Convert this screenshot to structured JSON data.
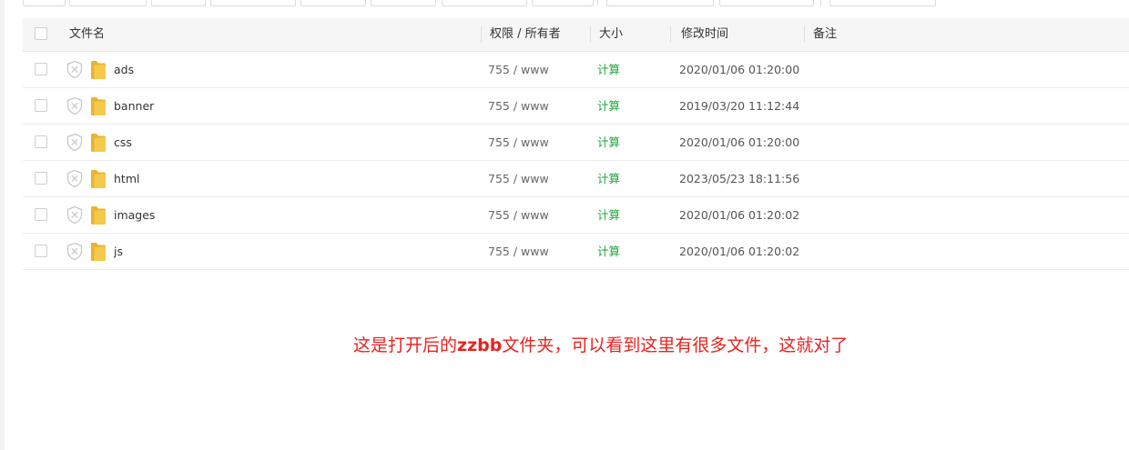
{
  "table": {
    "headers": {
      "name": "文件名",
      "perm": "权限 / 所有者",
      "size": "大小",
      "mtime": "修改时间",
      "note": "备注"
    },
    "rows": [
      {
        "name": "ads",
        "perm": "755 / www",
        "size": "计算",
        "mtime": "2020/01/06 01:20:00"
      },
      {
        "name": "banner",
        "perm": "755 / www",
        "size": "计算",
        "mtime": "2019/03/20 11:12:44"
      },
      {
        "name": "css",
        "perm": "755 / www",
        "size": "计算",
        "mtime": "2020/01/06 01:20:00"
      },
      {
        "name": "html",
        "perm": "755 / www",
        "size": "计算",
        "mtime": "2023/05/23 18:11:56"
      },
      {
        "name": "images",
        "perm": "755 / www",
        "size": "计算",
        "mtime": "2020/01/06 01:20:02"
      },
      {
        "name": "js",
        "perm": "755 / www",
        "size": "计算",
        "mtime": "2020/01/06 01:20:02"
      }
    ]
  },
  "annotation": {
    "before": "这是打开后的",
    "bold": "zzbb",
    "after": "文件夹，可以看到这里有很多文件，这就对了"
  },
  "colors": {
    "size_link": "#20a53a",
    "annotation": "#e8231f",
    "folder": "#f7c94b"
  },
  "icons": {
    "row_security": "shield-x-icon",
    "row_type": "folder-icon"
  }
}
